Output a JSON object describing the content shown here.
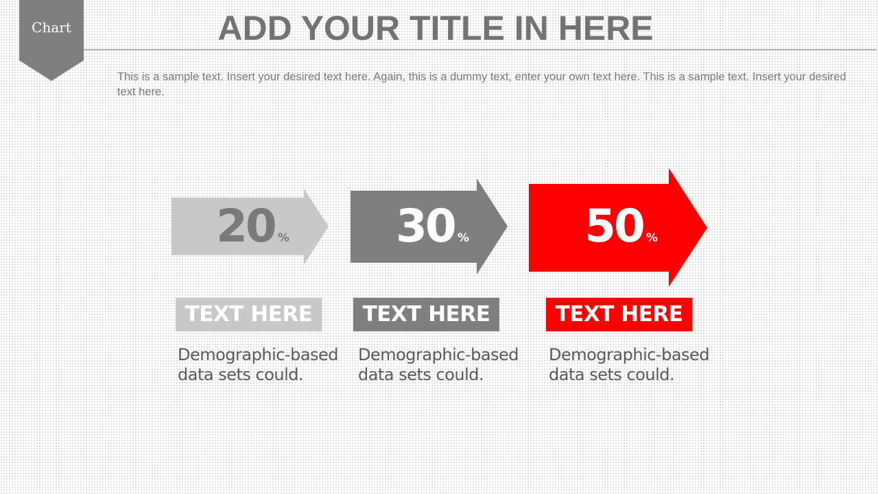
{
  "section_tag": "Chart",
  "title": "ADD YOUR TITLE IN HERE",
  "intro": "This is a sample text. Insert your desired text here. Again, this is a dummy text, enter your own text here. This is a sample text. Insert your desired text here.",
  "colors": {
    "light_gray": "#c8c8c8",
    "dark_gray": "#7f7f7f",
    "red": "#ff0000",
    "title": "#737373"
  },
  "steps": [
    {
      "value": "20",
      "unit": "%",
      "label": "TEXT HERE",
      "description": "Demographic-based data sets could."
    },
    {
      "value": "30",
      "unit": "%",
      "label": "TEXT HERE",
      "description": "Demographic-based data sets could."
    },
    {
      "value": "50",
      "unit": "%",
      "label": "TEXT HERE",
      "description": "Demographic-based data sets could."
    }
  ]
}
